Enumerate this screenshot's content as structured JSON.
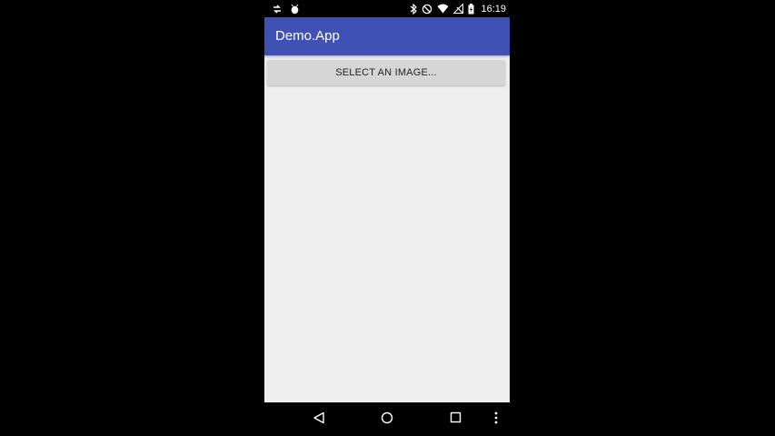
{
  "status_bar": {
    "time": "16:19",
    "icons_left": [
      "sync-icon",
      "android-debug-icon"
    ],
    "icons_right": [
      "bluetooth-icon",
      "do-not-disturb-icon",
      "wifi-icon",
      "no-signal-icon",
      "battery-charging-icon"
    ]
  },
  "app_bar": {
    "title": "Demo.App",
    "color": "#3f51b5"
  },
  "main": {
    "select_button_label": "SELECT AN IMAGE...",
    "background": "#efefef"
  },
  "nav_bar": {
    "items": [
      "back-icon",
      "home-icon",
      "recents-icon",
      "overflow-menu-icon"
    ]
  }
}
